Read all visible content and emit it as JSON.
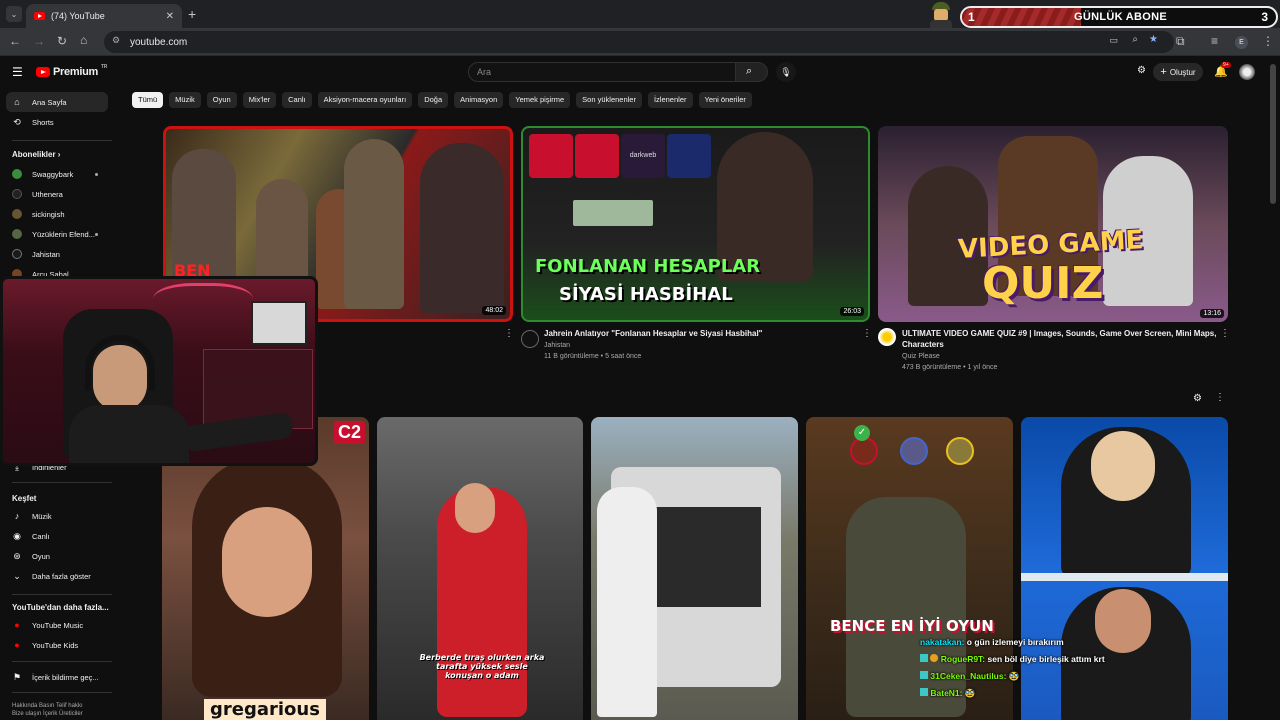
{
  "browser": {
    "tab_title": "(74) YouTube",
    "url": "youtube.com",
    "profile_letter": "E"
  },
  "stream_overlay": {
    "goal_current": "1",
    "goal_label": "GÜNLÜK ABONE",
    "goal_target": "3"
  },
  "header": {
    "logo_text": "Premium",
    "logo_badge": "TR",
    "search_placeholder": "Ara",
    "create_label": "Oluştur",
    "notif_count": "9+"
  },
  "chips": [
    "Tümü",
    "Müzik",
    "Oyun",
    "Mix'ler",
    "Canlı",
    "Aksiyon-macera oyunları",
    "Doğa",
    "Animasyon",
    "Yemek pişirme",
    "Son yüklenenler",
    "İzlenenler",
    "Yeni öneriler"
  ],
  "sidebar": {
    "home": "Ana Sayfa",
    "shorts": "Shorts",
    "subscriptions_heading": "Abonelikler",
    "subscriptions": [
      "Swaggybark",
      "Uthenera",
      "sickingish",
      "Yüzüklerin Efend...",
      "Jahistan",
      "Arcu Sabal"
    ],
    "downloads": "İndirilenler",
    "explore_heading": "Keşfet",
    "explore": [
      "Müzik",
      "Canlı",
      "Oyun"
    ],
    "show_more": "Daha fazla göster",
    "more_heading": "YouTube'dan daha fazla...",
    "more": [
      "YouTube Music",
      "YouTube Kids"
    ],
    "report": "İçerik bildirme geç...",
    "footer_row1": [
      "Hakkında",
      "Basın",
      "Telif hakkı"
    ],
    "footer_row2": [
      "Bize ulaşın",
      "İçerik Üreticiler"
    ]
  },
  "videos": [
    {
      "duration": "48:02",
      "thumb_text": "BEN"
    },
    {
      "title": "Jahrein Anlatıyor \"Fonlanan Hesaplar ve Siyasi Hasbihal\"",
      "channel": "Jahistan",
      "meta": "11 B görüntüleme • 5 saat önce",
      "duration": "26:03",
      "thumb_line1": "FONLANAN HESAPLAR",
      "thumb_line2": "SİYASİ HASBİHAL",
      "thumb_tag": "darkweb"
    },
    {
      "title_line1": "ULTIMATE VIDEO GAME QUIZ #9 | Images, Sounds, Game Over Screen, Mini Maps,",
      "title_line2": "Characters",
      "channel": "Quiz Please",
      "meta": "473 B görüntüleme • 1 yıl önce",
      "duration": "13:16",
      "thumb_line1": "VIDEO GAME",
      "thumb_line2": "QUIZ"
    }
  ],
  "shorts": [
    {
      "thumb_text": "gregarious",
      "badge": "C2"
    },
    {
      "thumb_caption": "Berberde tıraş olurken arka tarafta yüksek sesle konuşan o adam"
    },
    {},
    {
      "thumb_text": "BENCE EN İYİ OYUN"
    },
    {}
  ],
  "chat": [
    {
      "user": "nakatakan:",
      "text": "o gün izlemeyi bırakırım",
      "color": "#00e5ff"
    },
    {
      "user": "RogueR9T:",
      "text": "sen böl diye birleşik attım krt",
      "color": "#7cfc00"
    },
    {
      "user": "31Ceken_Nautilus:",
      "text": "🥸",
      "color": "#7cfc00"
    },
    {
      "user": "BateN1:",
      "text": "🥸",
      "color": "#7cfc00"
    }
  ],
  "colors": {
    "accent_red": "#ff0000",
    "background": "#0f0f0f",
    "chip_bg": "#272727"
  }
}
